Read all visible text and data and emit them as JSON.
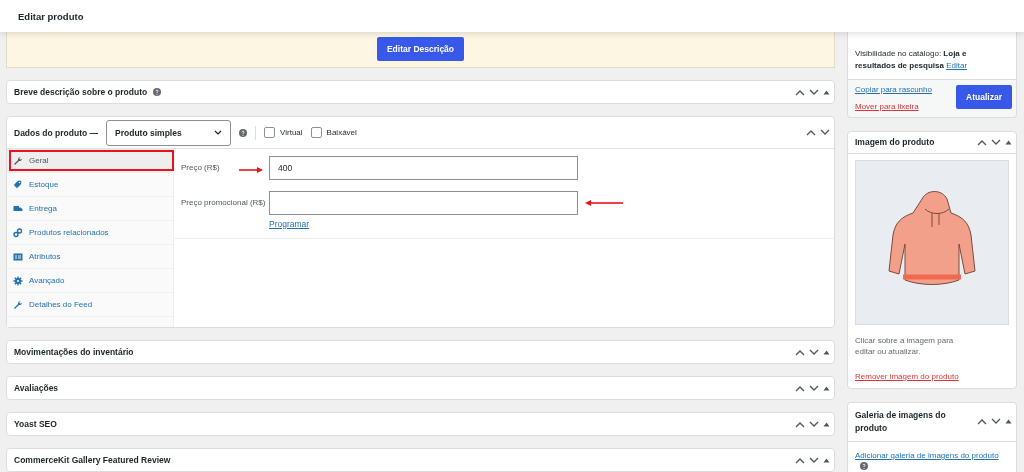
{
  "header": {
    "title": "Editar produto"
  },
  "description_box": {
    "button": "Editar Descrição"
  },
  "short_description": {
    "title": "Breve descrição sobre o produto"
  },
  "product_data": {
    "title": "Dados do produto —",
    "type_select": "Produto simples",
    "options": [
      {
        "label": "Virtual",
        "checked": false
      },
      {
        "label": "Baixável",
        "checked": false
      }
    ],
    "tabs": [
      {
        "label": "Geral",
        "selected": true
      },
      {
        "label": "Estoque",
        "selected": false
      },
      {
        "label": "Entrega",
        "selected": false
      },
      {
        "label": "Produtos relacionados",
        "selected": false
      },
      {
        "label": "Atributos",
        "selected": false
      },
      {
        "label": "Avançado",
        "selected": false
      },
      {
        "label": "Detalhes do Feed",
        "selected": false
      }
    ],
    "fields": [
      {
        "label": "Preço (R$)",
        "value": "400"
      },
      {
        "label": "Preço promocional (R$)",
        "link": "Programar"
      }
    ]
  },
  "panels": [
    {
      "title": "Movimentações do inventário"
    },
    {
      "title": "Avaliações"
    },
    {
      "title": "Yoast SEO"
    },
    {
      "title": "CommerceKit Gallery Featured Review"
    }
  ],
  "publish": {
    "visibility_label": "Visibilidade no catálogo:",
    "visibility_value": "Loja e resultados de pesquisa",
    "edit_link": "Editar",
    "copy_link": "Copiar para rascunho",
    "trash_link": "Mover para lixeira",
    "update_button": "Atualizar"
  },
  "product_image": {
    "title": "Imagem do produto",
    "hint": "Clicar sobre a imagem para editar ou atualizar.",
    "remove_link": "Remover imagem do produto"
  },
  "gallery": {
    "title": "Galeria de imagens do produto",
    "add_link": "Adicionar galeria de imagens do produto"
  }
}
